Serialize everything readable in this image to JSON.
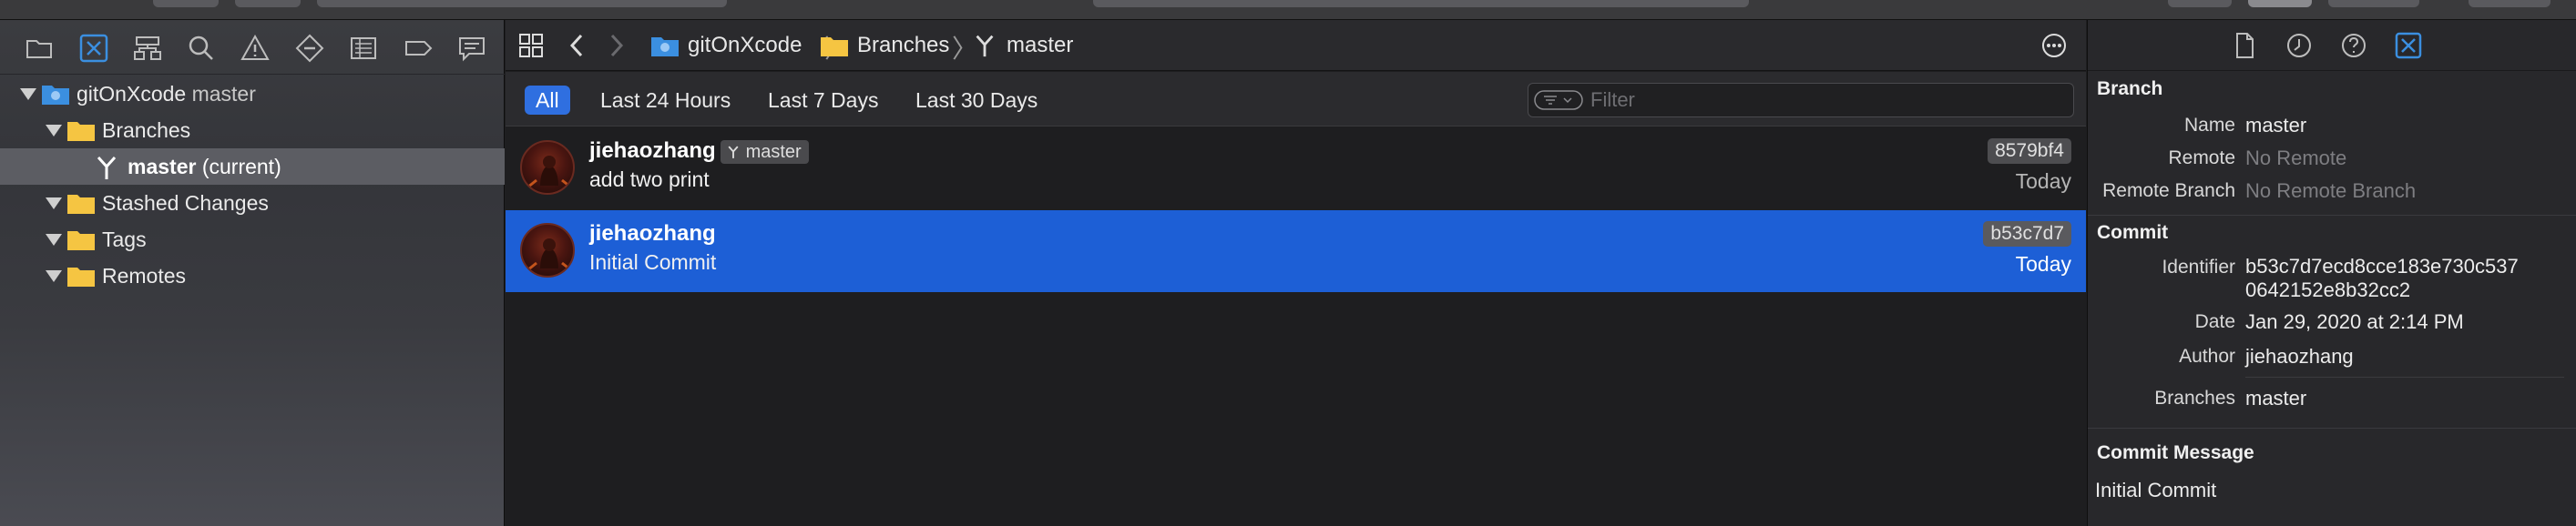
{
  "navigator": {
    "project_name": "gitOnXcode",
    "project_branch": "master",
    "items": [
      {
        "label": "Branches"
      },
      {
        "label": "master",
        "suffix": "(current)"
      },
      {
        "label": "Stashed Changes"
      },
      {
        "label": "Tags"
      },
      {
        "label": "Remotes"
      }
    ]
  },
  "jumpbar": {
    "crumbs": [
      "gitOnXcode",
      "Branches",
      "master"
    ]
  },
  "filterbar": {
    "tabs": [
      "All",
      "Last 24 Hours",
      "Last 7 Days",
      "Last 30 Days"
    ],
    "active_tab": "All",
    "filter_placeholder": "Filter"
  },
  "commits": [
    {
      "author": "jiehaozhang",
      "branch_badge": "master",
      "message": "add two print",
      "hash": "8579bf4",
      "date": "Today"
    },
    {
      "author": "jiehaozhang",
      "message": "Initial Commit",
      "hash": "b53c7d7",
      "date": "Today"
    }
  ],
  "inspector": {
    "branch_section": "Branch",
    "name_key": "Name",
    "name_val": "master",
    "remote_key": "Remote",
    "remote_val": "No Remote",
    "remote_branch_key": "Remote Branch",
    "remote_branch_val": "No Remote Branch",
    "commit_section": "Commit",
    "identifier_key": "Identifier",
    "identifier_line1": "b53c7d7ecd8cce183e730c537",
    "identifier_line2": "0642152e8b32cc2",
    "date_key": "Date",
    "date_val": "Jan 29, 2020 at 2:14 PM",
    "author_key": "Author",
    "author_val": "jiehaozhang",
    "branches_key": "Branches",
    "branches_val": "master",
    "message_section": "Commit Message",
    "message_val": "Initial Commit"
  },
  "colors": {
    "accent": "#2f6fe0",
    "selection": "#1d5fd6",
    "folder": "#f5c542",
    "project_icon": "#3b8fe0"
  },
  "icons": {
    "navigator_tabs": [
      "folder-icon",
      "source-control-icon",
      "hierarchy-icon",
      "search-icon",
      "warning-icon",
      "test-icon",
      "debug-icon",
      "breakpoint-icon",
      "report-icon"
    ],
    "inspector_tabs": [
      "file-icon",
      "history-icon",
      "help-icon",
      "attributes-icon"
    ]
  }
}
